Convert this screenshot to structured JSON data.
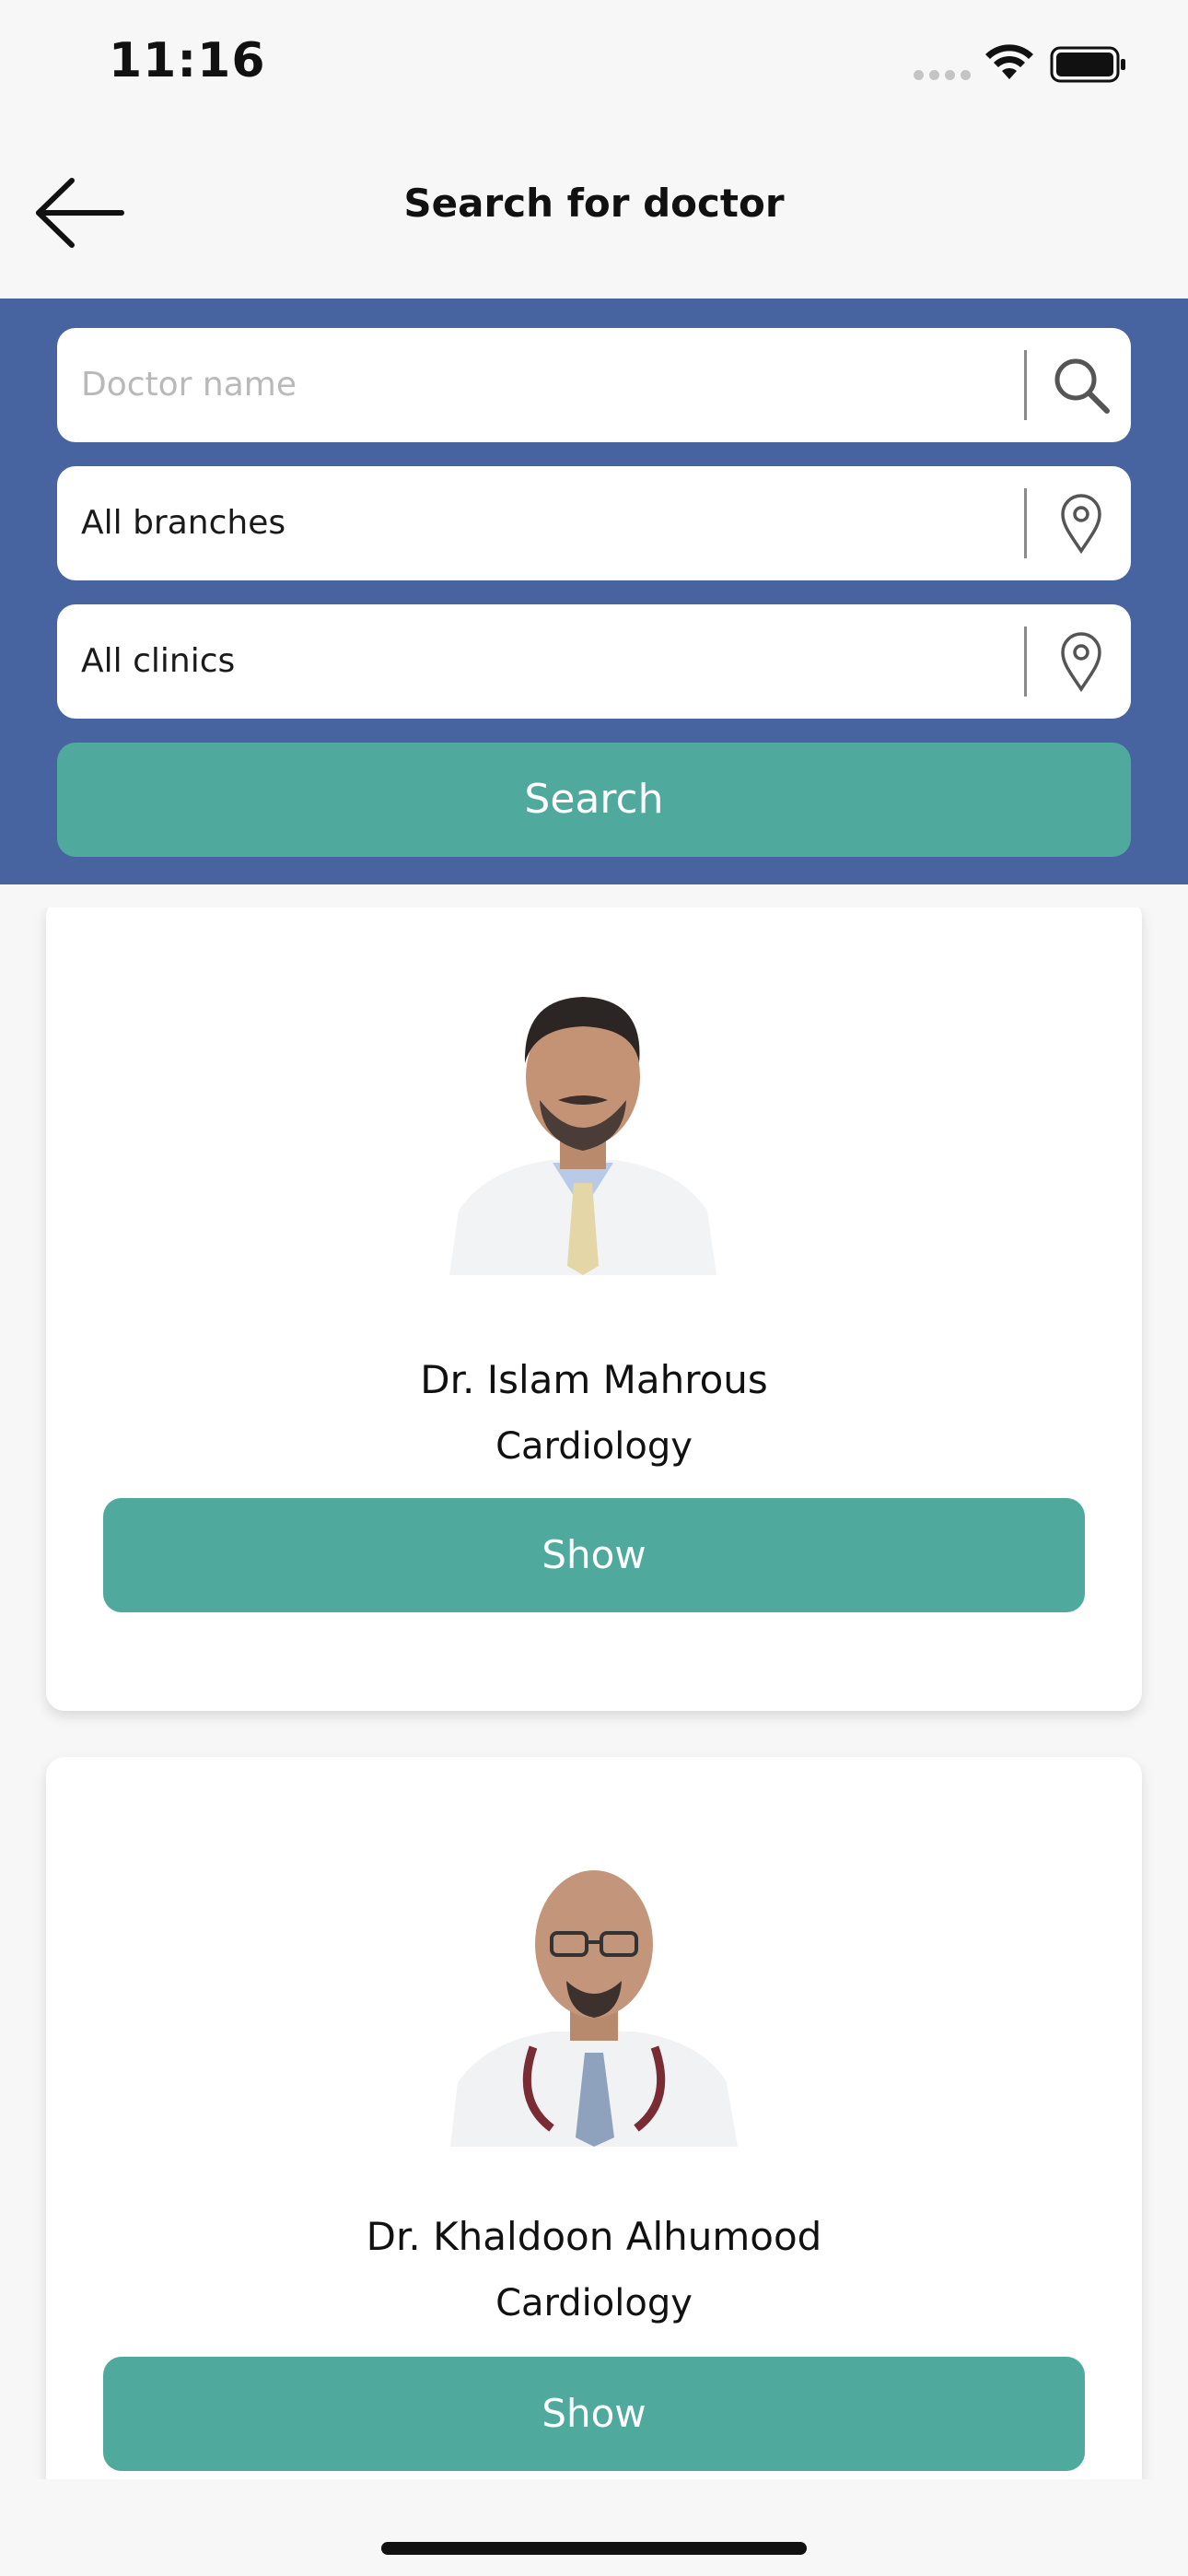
{
  "status_bar": {
    "time": "11:16",
    "icons": [
      "cellular-signal-icon",
      "wifi-icon",
      "battery-icon"
    ]
  },
  "nav": {
    "title": "Search for doctor",
    "back_icon": "arrow-left-icon"
  },
  "search": {
    "doctor_name": {
      "value": "",
      "placeholder": "Doctor name",
      "icon": "search-icon"
    },
    "branch": {
      "value": "All branches",
      "icon": "location-pin-icon"
    },
    "clinic": {
      "value": "All clinics",
      "icon": "location-pin-icon"
    },
    "button_label": "Search"
  },
  "doctors": [
    {
      "name": "Dr. Islam Mahrous",
      "specialty": "Cardiology",
      "button_label": "Show"
    },
    {
      "name": "Dr. Khaldoon Alhumood",
      "specialty": "Cardiology",
      "button_label": "Show"
    }
  ],
  "colors": {
    "panel_blue": "#4763a0",
    "accent_teal": "#4fa99c",
    "background": "#f7f7f7"
  }
}
